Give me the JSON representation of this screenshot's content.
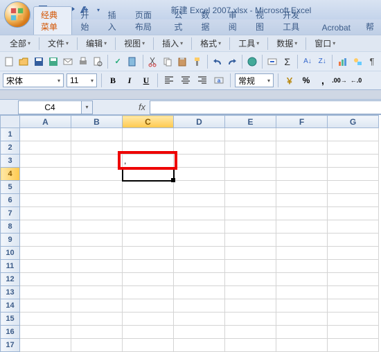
{
  "window": {
    "title": "新建 Excel 2007.xlsx - Microsoft Excel"
  },
  "ribbon": {
    "tabs": [
      "经典菜单",
      "开始",
      "插入",
      "页面布局",
      "公式",
      "数据",
      "审阅",
      "视图",
      "开发工具",
      "Acrobat",
      "帮"
    ],
    "active": 0
  },
  "menubar": [
    "全部",
    "文件",
    "编辑",
    "视图",
    "插入",
    "格式",
    "工具",
    "数据",
    "窗口"
  ],
  "format": {
    "font": "宋体",
    "size": "11",
    "numfmt": "常规"
  },
  "namebox": "C4",
  "formula": "",
  "columns": [
    "A",
    "B",
    "C",
    "D",
    "E",
    "F",
    "G"
  ],
  "rows": [
    "1",
    "2",
    "3",
    "4",
    "5",
    "6",
    "7",
    "8",
    "9",
    "10",
    "11",
    "12",
    "13",
    "14",
    "15",
    "16",
    "17"
  ],
  "selected_col": "C",
  "selected_row": "4",
  "cells": {
    "C3": ","
  },
  "highlight": {
    "cell": "C3"
  }
}
